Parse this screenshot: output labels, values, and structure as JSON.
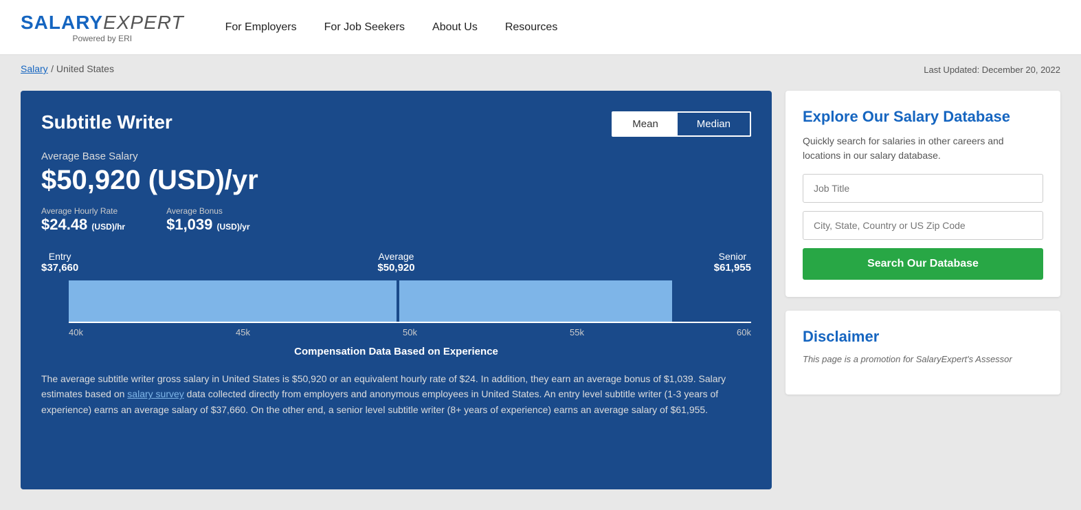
{
  "header": {
    "logo_salary": "SALARY",
    "logo_expert": "EXPERT",
    "logo_powered": "Powered by ERI",
    "nav": {
      "for_employers": "For Employers",
      "for_job_seekers": "For Job Seekers",
      "about_us": "About Us",
      "resources": "Resources"
    }
  },
  "breadcrumb": {
    "salary_link": "Salary",
    "separator": " / ",
    "current": "United States"
  },
  "last_updated": "Last Updated: December 20, 2022",
  "main": {
    "job_title": "Subtitle Writer",
    "toggle": {
      "mean_label": "Mean",
      "median_label": "Median",
      "active": "mean"
    },
    "avg_base_label": "Average Base Salary",
    "avg_salary": "$50,920 (USD)/yr",
    "hourly_label": "Average Hourly Rate",
    "hourly_value": "$24.48",
    "hourly_unit": "(USD)/hr",
    "bonus_label": "Average Bonus",
    "bonus_value": "$1,039",
    "bonus_unit": "(USD)/yr",
    "chart": {
      "entry_label": "Entry",
      "entry_value": "$37,660",
      "average_label": "Average",
      "average_value": "$50,920",
      "senior_label": "Senior",
      "senior_value": "$61,955",
      "x_labels": [
        "40k",
        "45k",
        "50k",
        "55k",
        "60k"
      ],
      "caption": "Compensation Data Based on Experience"
    },
    "description": "The average subtitle writer gross salary in United States is $50,920 or an equivalent hourly rate of $24. In addition, they earn an average bonus of $1,039. Salary estimates based on salary survey data collected directly from employers and anonymous employees in United States. An entry level subtitle writer (1-3 years of experience) earns an average salary of $37,660. On the other end, a senior level subtitle writer (8+ years of experience) earns an average salary of $61,955.",
    "description_link_text": "salary survey"
  },
  "sidebar": {
    "explore": {
      "title": "Explore Our Salary Database",
      "description": "Quickly search for salaries in other careers and locations in our salary database.",
      "job_title_placeholder": "Job Title",
      "location_placeholder": "City, State, Country or US Zip Code",
      "search_button": "Search Our Database"
    },
    "disclaimer": {
      "title": "Disclaimer",
      "text": "This page is a promotion for SalaryExpert's Assessor"
    }
  }
}
